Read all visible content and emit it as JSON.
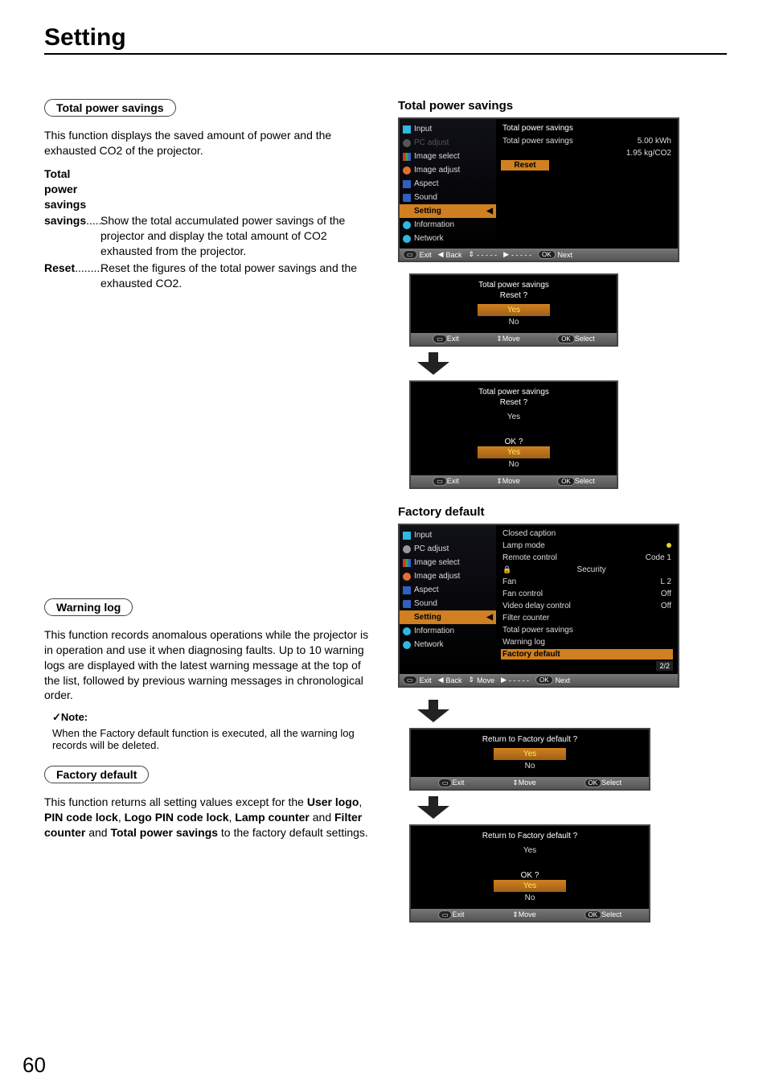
{
  "page_title": "Setting",
  "page_number": "60",
  "sections": {
    "tps": {
      "pill": "Total power savings",
      "intro": "This function displays the saved amount of power and the exhausted CO2 of the projector.",
      "def1_term": "Total power savings",
      "def1_dots": "......",
      "def1_desc": "Show the total accumulated power savings of the projector and display the total amount of CO2 exhausted from the projector.",
      "def2_term": "Reset",
      "def2_dots": ".........",
      "def2_desc": "Reset the figures of the total power savings and the exhausted CO2."
    },
    "warning": {
      "pill": "Warning log",
      "body": "This function records anomalous operations while the projector is in operation and use it when diagnosing faults. Up to 10 warning logs are displayed with the latest warning message at the top of the list, followed by previous warning messages in chronological order.",
      "note_head": "Note:",
      "note_body": "When the Factory default function is executed, all the warning log records will be deleted."
    },
    "factory": {
      "pill": "Factory default",
      "body_pre": "This function returns all setting values except for the ",
      "b1": "User logo",
      "b2": "PIN code lock",
      "b3": "Logo PIN code lock",
      "b4": "Lamp counter",
      "b5": "Filter counter",
      "b6": "Total power savings",
      "sep_comma": ", ",
      "sep_and": " and ",
      "body_post": " to the factory default settings."
    }
  },
  "figures": {
    "tps_title": "Total power savings",
    "factory_title": "Factory default"
  },
  "sidebar_items": [
    {
      "label": "Input"
    },
    {
      "label": "PC adjust"
    },
    {
      "label": "Image select"
    },
    {
      "label": "Image adjust"
    },
    {
      "label": "Aspect"
    },
    {
      "label": "Sound"
    },
    {
      "label": "Setting"
    },
    {
      "label": "Information"
    },
    {
      "label": "Network"
    }
  ],
  "osd_tps": {
    "header": "Total power savings",
    "row1_label": "Total power savings",
    "row1_val1": "5.00  kWh",
    "row1_val2": "1.95  kg/CO2",
    "reset": "Reset"
  },
  "osd_factory_items": [
    {
      "label": "Closed caption",
      "val": ""
    },
    {
      "label": "Lamp mode",
      "val": "",
      "dot": true
    },
    {
      "label": "Remote control",
      "val": "Code 1"
    },
    {
      "label": "Security",
      "val": "",
      "lock": true
    },
    {
      "label": "Fan",
      "val": "L 2"
    },
    {
      "label": "Fan control",
      "val": "Off"
    },
    {
      "label": "Video delay control",
      "val": "Off"
    },
    {
      "label": "Filter counter",
      "val": ""
    },
    {
      "label": "Total power savings",
      "val": ""
    },
    {
      "label": "Warning log",
      "val": ""
    },
    {
      "label": "Factory default",
      "val": "",
      "orange": true
    }
  ],
  "osd_factory_page": "2/2",
  "footer": {
    "exit": "Exit",
    "back": "Back",
    "dashes": "- - - - -",
    "next": "Next",
    "move": "Move",
    "select": "Select",
    "ok": "OK",
    "menu_icon": "▭"
  },
  "dialogs": {
    "tps_reset_q": "Total power savings\nReset ?",
    "yes": "Yes",
    "no": "No",
    "ok_q": "OK ?",
    "factory_q": "Return to Factory default ?"
  }
}
